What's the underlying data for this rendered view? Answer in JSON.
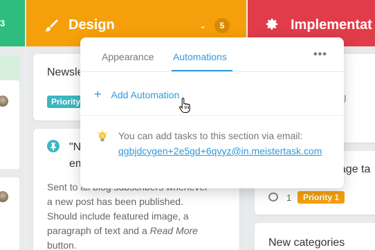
{
  "columns": {
    "left": {
      "count": "3"
    },
    "design": {
      "title": "Design",
      "count": "5",
      "color": "#f5a00b",
      "icon": "paintbrush-icon"
    },
    "implementation": {
      "title": "Implementat",
      "color": "#e13c4a",
      "icon": "gear-icon"
    }
  },
  "design_cards": [
    {
      "title": "Newsle",
      "badge": "Priority"
    },
    {
      "title_line1": "\"N",
      "title_line2": "em",
      "desc_line1": "Sent to all blog subscribers whenever",
      "desc_line2": "a new post has been published.",
      "desc_line3": "Should include featured image, a",
      "desc_line4_prefix": "paragraph of text and a ",
      "desc_line4_em": "Read More",
      "desc_line5": "button."
    }
  ],
  "impl_cards": [
    {
      "fragment": "ing"
    },
    {
      "fragment": "nage ta",
      "comments": "1",
      "badge": "Priority 1"
    },
    {
      "title": "New categories"
    }
  ],
  "popup": {
    "tabs": [
      "Appearance",
      "Automations"
    ],
    "active_tab": "Automations",
    "more_label": "•••",
    "add_label": "Add Automation",
    "add_symbol": "+",
    "hint": "You can add tasks to this section via email:",
    "email": "qgbjdcygen+2e5gd+6qvyz@in.meistertask.com",
    "accent": "#2d9be0"
  }
}
